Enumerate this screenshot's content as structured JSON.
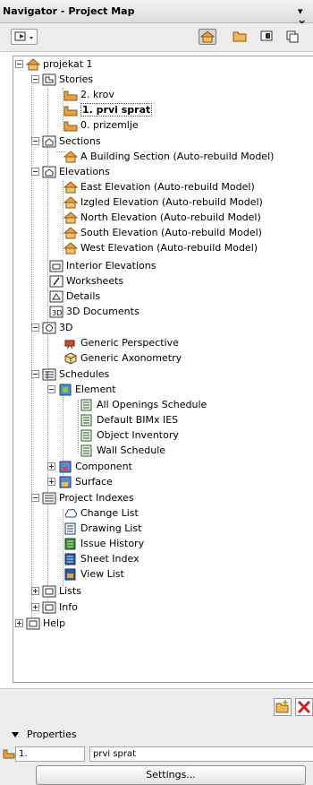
{
  "window": {
    "title": "Navigator - Project Map",
    "controls": "▾ ×"
  },
  "toolbar": {
    "buttons": [
      "navigator-menu",
      "project-map",
      "view-map",
      "layout-book",
      "publisher-sets"
    ],
    "active": "project-map"
  },
  "tree": {
    "root": "projekat 1",
    "stories": "Stories",
    "story_items": [
      "2. krov",
      "1. prvi sprat",
      "0. prizemlje"
    ],
    "sections": "Sections",
    "section_items": [
      "A Building Section (Auto-rebuild Model)"
    ],
    "elevations": "Elevations",
    "elevation_items": [
      "East Elevation (Auto-rebuild Model)",
      "Izgled Elevation (Auto-rebuild Model)",
      "North Elevation (Auto-rebuild Model)",
      "South Elevation (Auto-rebuild Model)",
      "West Elevation (Auto-rebuild Model)"
    ],
    "interior_elevations": "Interior Elevations",
    "worksheets": "Worksheets",
    "details": "Details",
    "documents_3d": "3D Documents",
    "view_3d": "3D",
    "items_3d": [
      "Generic Perspective",
      "Generic Axonometry"
    ],
    "schedules": "Schedules",
    "element": "Element",
    "element_items": [
      "All Openings Schedule",
      "Default BIMx IES",
      "Object Inventory",
      "Wall Schedule"
    ],
    "component": "Component",
    "surface": "Surface",
    "project_indexes": "Project Indexes",
    "index_items": [
      "Change List",
      "Drawing List",
      "Issue History",
      "Sheet Index",
      "View List"
    ],
    "lists": "Lists",
    "info": "Info",
    "help": "Help"
  },
  "properties": {
    "title": "Properties",
    "story_number": "1.",
    "story_name": "prvi sprat",
    "settings_label": "Settings..."
  },
  "colors": {
    "folder": "#e8a040",
    "selection_border": "#555555",
    "delete_red": "#d02020"
  }
}
